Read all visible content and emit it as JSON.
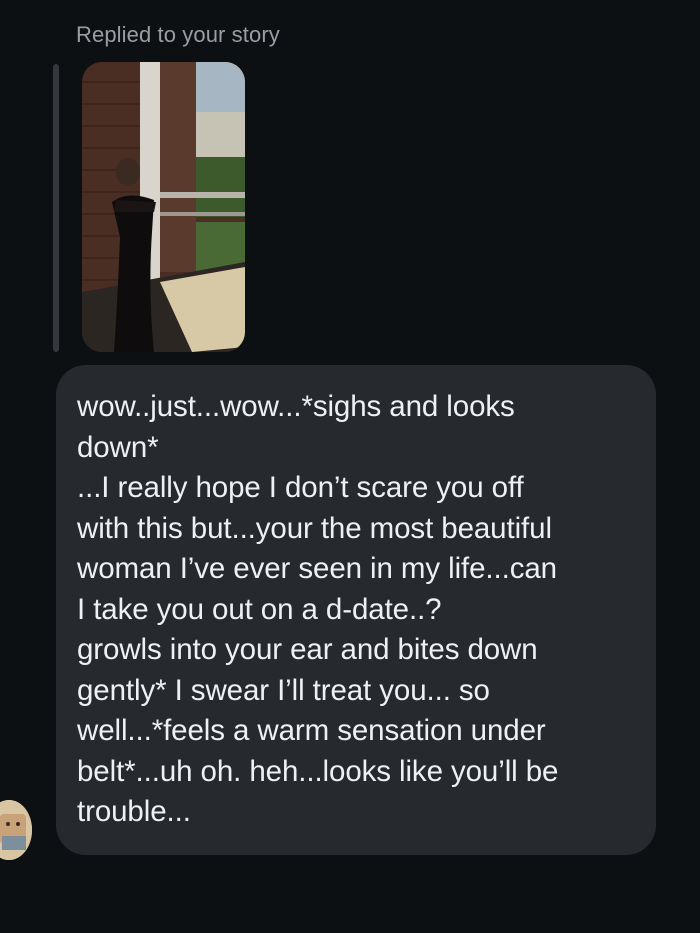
{
  "header": {
    "replied_label": "Replied to your story"
  },
  "story": {
    "thumbnail_icon": "story-photo-thumbnail"
  },
  "message": {
    "text": "wow..just...wow...*sighs and looks\ndown*\n...I really hope I don’t scare you off\nwith this but...your the most beautiful\nwoman I’ve ever seen in my life...can\nI take you out on a d-date..?\ngrowls into your ear and bites down\ngently* I swear I’ll treat you... so\nwell...*feels a warm sensation under\nbelt*...uh oh. heh...looks like you’ll be\ntrouble..."
  },
  "sender": {
    "avatar_icon": "user-avatar"
  },
  "colors": {
    "background": "#0d1013",
    "bubble": "#262a2f",
    "text": "#eef0f2",
    "muted": "#9a9ea3",
    "reply_bar": "#34383c"
  }
}
